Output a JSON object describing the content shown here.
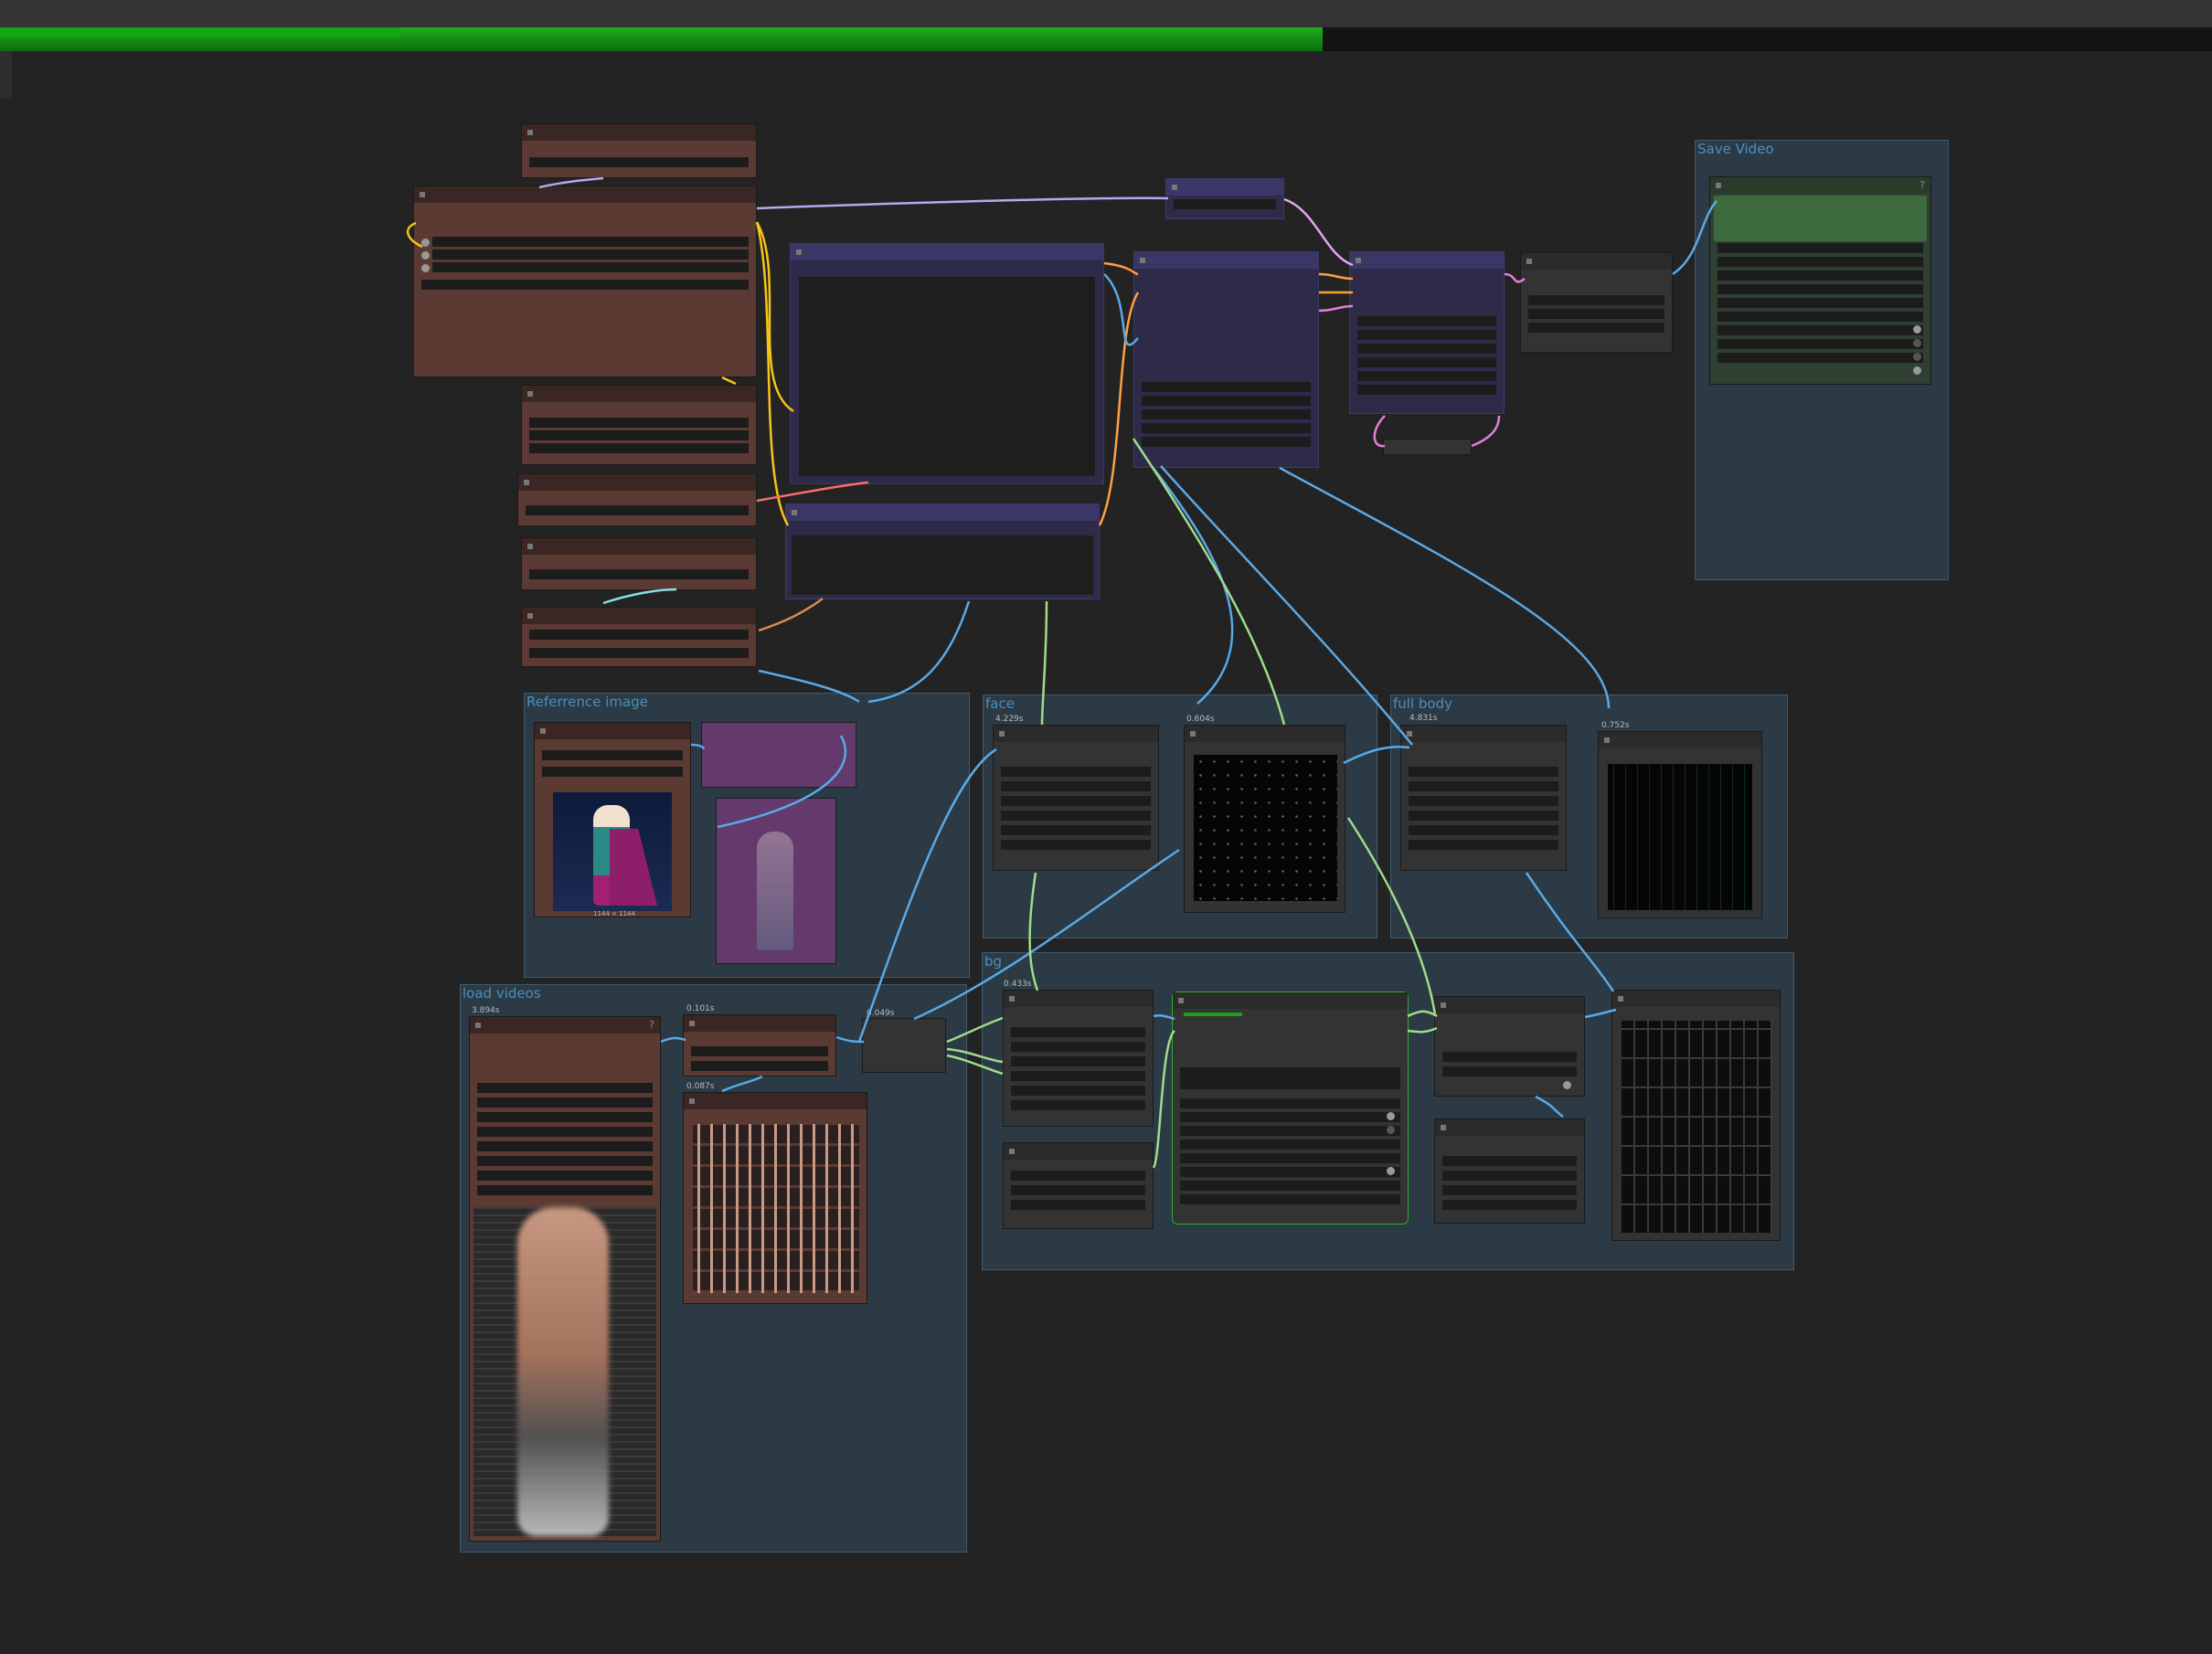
{
  "progress": {
    "overall": 0.598,
    "current": 0.181
  },
  "groups": {
    "save_video": "Save Video",
    "reference_image": "Referrence image",
    "face": "face",
    "full_body": "full body",
    "bg": "bg",
    "load_videos": "load videos"
  },
  "timings": {
    "face_a": "4.229s",
    "face_b": "0.604s",
    "full_body_a": "4.831s",
    "full_body_b": "0.752s",
    "bg_a": "0.433s",
    "load_a": "3.894s",
    "load_b": "0.101s",
    "load_c": "0.049s",
    "load_d": "0.087s"
  },
  "reference_image": {
    "size_label": "1144 × 1144"
  },
  "help_mark": "?",
  "colors": {
    "background": "#232323",
    "group_fill": "#2b3a44",
    "node_brown": "#5a3a32",
    "node_navy": "#2e2b49",
    "progress_green": "#1aa01a",
    "wire_blue": "#5aa9e6",
    "wire_yellow": "#f5c518",
    "wire_pink": "#e27fd9",
    "wire_green": "#9fdc8a"
  }
}
